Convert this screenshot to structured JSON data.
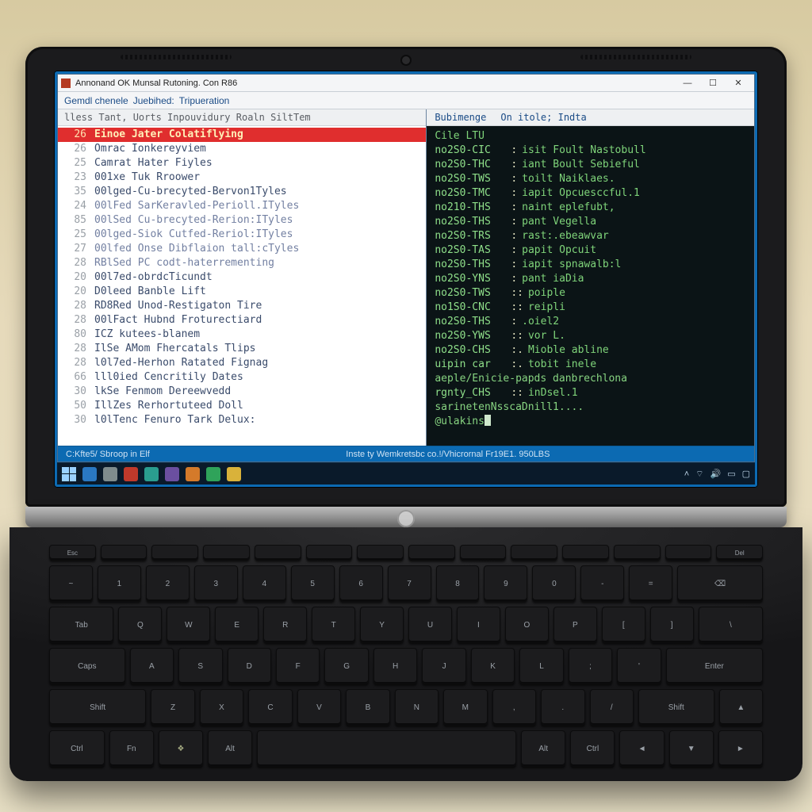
{
  "window": {
    "title": "Annonand OK Munsal Rutoning. Con R86",
    "menu": {
      "a": "Gemdl chenele",
      "b": "Juebihed:",
      "c": "Tripueration"
    }
  },
  "left": {
    "header": "lless  Tant, Uorts Inpouvidury Roaln SiltTem",
    "rows": [
      {
        "n": "26",
        "t": "Einoe Jater Colatiflying",
        "sel": true
      },
      {
        "n": "26",
        "t": "Omrac Ionkereyviem"
      },
      {
        "n": "25",
        "t": "Camrat Hater Fiyles"
      },
      {
        "n": "23",
        "t": "001xe Tuk Rroower"
      },
      {
        "n": "35",
        "t": "00lged-Cu-brecyted-Bervon1Tyles"
      },
      {
        "n": "24",
        "t": "00lFed SarKeravled-Perioll.ITyles"
      },
      {
        "n": "85",
        "t": "00lSed Cu-brecyted-Rerion:ITyles"
      },
      {
        "n": "25",
        "t": "00lged-Siok Cutfed-Reriol:ITyles"
      },
      {
        "n": "27",
        "t": "00lfed Onse Dibflaion tall:cTyles"
      },
      {
        "n": "28",
        "t": "RBlSed PC codt-haterrementing"
      },
      {
        "n": "20",
        "t": "00l7ed-obrdcTicundt"
      },
      {
        "n": "20",
        "t": "D0leed Banble Lift"
      },
      {
        "n": "28",
        "t": "RD8Red Unod-Restigaton Tire"
      },
      {
        "n": "28",
        "t": "00lFact Hubnd Froturectiard"
      },
      {
        "n": "80",
        "t": "ICZ kutees-blanem"
      },
      {
        "n": "28",
        "t": "IlSe AMom Fhercatals Tlips"
      },
      {
        "n": "28",
        "t": "l0l7ed-Herhon Ratated Fignag"
      },
      {
        "n": "66",
        "t": "lll0ied Cencritily Dates"
      },
      {
        "n": "30",
        "t": "lkSe Fenmom Dereewvedd"
      },
      {
        "n": "50",
        "t": "IllZes Rerhortuteed Doll"
      },
      {
        "n": "30",
        "t": "l0lTenc Fenuro Tark Delux:"
      }
    ]
  },
  "right": {
    "tabs": {
      "a": "Bubimenge",
      "b": "On itole; Indta"
    },
    "header": "Cile  LTU",
    "lines": [
      {
        "k": "no2S0-CIC",
        "s": ":",
        "v": "isit Foult Nastobull"
      },
      {
        "k": "no2S0-THC",
        "s": ":",
        "v": "iant Boult Sebieful"
      },
      {
        "k": "no2S0-TWS",
        "s": ":",
        "v": "toilt Naiklaes."
      },
      {
        "k": "no2S0-TMC",
        "s": ":",
        "v": "iapit Opcuesccful.1"
      },
      {
        "k": "no210-THS",
        "s": ":",
        "v": "naint eplefubt,"
      },
      {
        "k": "no2S0-THS",
        "s": ":",
        "v": "pant Vegella"
      },
      {
        "k": "no2S0-TRS",
        "s": ":",
        "v": "rast:.ebeawvar"
      },
      {
        "k": "no2S0-TAS",
        "s": ":",
        "v": "papit Opcuit"
      },
      {
        "k": "no2S0-THS",
        "s": ":",
        "v": "iapit spnawalb:l"
      },
      {
        "k": "no2S0-YNS",
        "s": ":",
        "v": "pant iaDia"
      },
      {
        "k": "no2S0-TWS",
        "s": "::",
        "v": "poiple"
      },
      {
        "k": "no1S0-CNC",
        "s": "::",
        "v": "reipli"
      },
      {
        "k": "no2S0-THS",
        "s": ":",
        "v": ".oiel2"
      },
      {
        "k": "no2S0-YWS",
        "s": "::",
        "v": "vor L."
      },
      {
        "k": "no2S0-CHS",
        "s": ":.",
        "v": "Mioble abline"
      },
      {
        "k": "uipin car",
        "s": ":.",
        "v": "tobit inele"
      },
      {
        "plain": "aeple/Enicie-papds danbrechlona"
      },
      {
        "k": "rgnty_CHS",
        "s": "::",
        "v": "inDsel.1"
      },
      {
        "plain": "sarinetenNsscaDnill1...."
      },
      {
        "prompt": "@ulakins"
      }
    ]
  },
  "status": {
    "left": "C:Kfte5/ Sbroop in Elf",
    "center": "Inste ty Wemkretsbc co.!/Vhicrornal  Fr19E1. 950LBS",
    "right": ""
  },
  "tray": {
    "time": "",
    "notif": ""
  }
}
